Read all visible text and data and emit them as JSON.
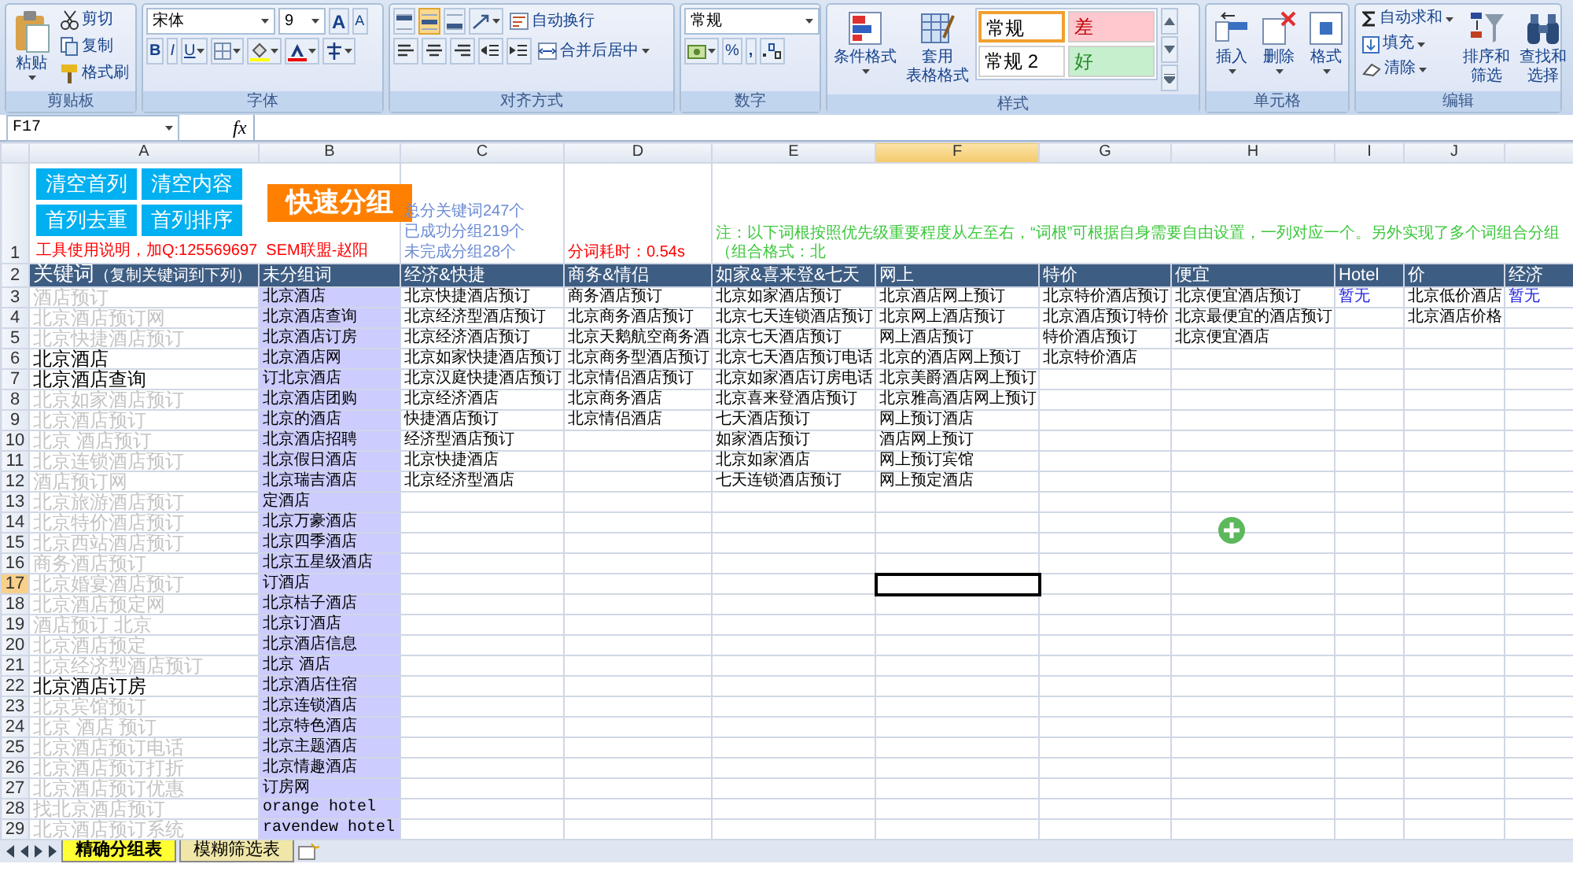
{
  "ribbon": {
    "clipboard": {
      "label": "剪贴板",
      "paste": "粘贴",
      "cut": "剪切",
      "copy": "复制",
      "format_painter": "格式刷"
    },
    "font": {
      "label": "字体",
      "font_name": "宋体",
      "font_size": "9",
      "grow": "A",
      "shrink": "A",
      "bold": "B",
      "italic": "I",
      "underline": "U"
    },
    "alignment": {
      "label": "对齐方式",
      "wrap_text": "自动换行",
      "merge_center": "合并后居中",
      "vertical_align": [
        {
          "selected": false
        },
        {
          "selected": true
        },
        {
          "selected": false
        }
      ]
    },
    "number": {
      "label": "数字",
      "format": "常规",
      "percent": "%",
      "comma": ","
    },
    "styles": {
      "label": "样式",
      "conditional_format": "条件格式",
      "table_format": [
        "套用",
        "表格格式"
      ],
      "cell_styles": [
        {
          "label": "常规",
          "color": "#ffffff",
          "selected": true
        },
        {
          "label": "差",
          "color": "#ffc7ce",
          "selected": false
        },
        {
          "label": "常规 2",
          "color": "#ffffff",
          "selected": false
        },
        {
          "label": "好",
          "color": "#c6efce",
          "selected": false
        }
      ]
    },
    "cells": {
      "label": "单元格",
      "buttons": [
        "插入",
        "删除",
        "格式"
      ]
    },
    "editing": {
      "label": "编辑",
      "autosum": "自动求和",
      "fill": "填充",
      "clear": "清除",
      "sort_filter": [
        "排序和",
        "筛选"
      ],
      "find_select": [
        "查找和",
        "选择"
      ]
    }
  },
  "formula_bar": {
    "name_box": "F17",
    "fx": "fx"
  },
  "sheet": {
    "columns": [
      {
        "letter": "A",
        "selected": false
      },
      {
        "letter": "B",
        "selected": false
      },
      {
        "letter": "C",
        "selected": false
      },
      {
        "letter": "D",
        "selected": false
      },
      {
        "letter": "E",
        "selected": false
      },
      {
        "letter": "F",
        "selected": true
      },
      {
        "letter": "G",
        "selected": false
      },
      {
        "letter": "H",
        "selected": false
      },
      {
        "letter": "I",
        "selected": false
      },
      {
        "letter": "J",
        "selected": false
      }
    ],
    "rows": [
      {
        "number": "1",
        "selected": false
      },
      {
        "number": "2",
        "selected": false
      },
      {
        "number": "3",
        "selected": false
      },
      {
        "number": "4",
        "selected": false
      },
      {
        "number": "5",
        "selected": false
      },
      {
        "number": "6",
        "selected": false
      },
      {
        "number": "7",
        "selected": false
      },
      {
        "number": "8",
        "selected": false
      },
      {
        "number": "9",
        "selected": false
      },
      {
        "number": "10",
        "selected": false
      },
      {
        "number": "11",
        "selected": false
      },
      {
        "number": "12",
        "selected": false
      },
      {
        "number": "13",
        "selected": false
      },
      {
        "number": "14",
        "selected": false
      },
      {
        "number": "15",
        "selected": false
      },
      {
        "number": "16",
        "selected": false
      },
      {
        "number": "17",
        "selected": true
      },
      {
        "number": "18",
        "selected": false
      },
      {
        "number": "19",
        "selected": false
      },
      {
        "number": "20",
        "selected": false
      },
      {
        "number": "21",
        "selected": false
      },
      {
        "number": "22",
        "selected": false
      },
      {
        "number": "23",
        "selected": false
      },
      {
        "number": "24",
        "selected": false
      },
      {
        "number": "25",
        "selected": false
      },
      {
        "number": "26",
        "selected": false
      },
      {
        "number": "27",
        "selected": false
      },
      {
        "number": "28",
        "selected": false
      },
      {
        "number": "29",
        "selected": false
      }
    ],
    "tools": {
      "buttons": [
        "清空首列",
        "清空内容",
        "首列去重",
        "首列排序"
      ],
      "group_button": "快速分组",
      "note": "工具使用说明，加Q:125569697  SEM联盟-赵阳"
    },
    "stats": [
      "总分关键词247个",
      "已成功分组219个",
      "未完成分组28个"
    ],
    "timing": "分词耗时：0.54s",
    "notice": "注：以下词根按照优先级重要程度从左至右，“词根”可根据自身需要自由设置，一列对应一个。另外实现了多个词组合分组（组合格式：北",
    "keyword_header": {
      "label": "关键词",
      "note": "（复制关键词到下列）"
    },
    "keywords": [
      {
        "text": "酒店预订",
        "dimmed": true
      },
      {
        "text": "北京酒店预订网",
        "dimmed": true
      },
      {
        "text": "北京快捷酒店预订",
        "dimmed": true
      },
      {
        "text": "北京酒店",
        "dimmed": false
      },
      {
        "text": "北京酒店查询",
        "dimmed": false
      },
      {
        "text": "北京如家酒店预订",
        "dimmed": true
      },
      {
        "text": "北京酒店预订",
        "dimmed": true
      },
      {
        "text": "北京 酒店预订",
        "dimmed": true
      },
      {
        "text": "北京连锁酒店预订",
        "dimmed": true
      },
      {
        "text": "酒店预订网",
        "dimmed": true
      },
      {
        "text": "北京旅游酒店预订",
        "dimmed": true
      },
      {
        "text": "北京特价酒店预订",
        "dimmed": true
      },
      {
        "text": "北京西站酒店预订",
        "dimmed": true
      },
      {
        "text": "商务酒店预订",
        "dimmed": true
      },
      {
        "text": "北京婚宴酒店预订",
        "dimmed": true
      },
      {
        "text": "北京酒店预定网",
        "dimmed": true
      },
      {
        "text": "酒店预订 北京",
        "dimmed": true
      },
      {
        "text": "北京酒店预定",
        "dimmed": true
      },
      {
        "text": "北京经济型酒店预订",
        "dimmed": true
      },
      {
        "text": "北京酒店订房",
        "dimmed": false
      },
      {
        "text": "北京宾馆预订",
        "dimmed": true
      },
      {
        "text": "北京 酒店 预订",
        "dimmed": true
      },
      {
        "text": "北京酒店预订电话",
        "dimmed": true
      },
      {
        "text": "北京酒店预订打折",
        "dimmed": true
      },
      {
        "text": "北京酒店预订优惠",
        "dimmed": true
      },
      {
        "text": "找北京酒店预订",
        "dimmed": true
      },
      {
        "text": "北京酒店预订系统",
        "dimmed": true
      }
    ],
    "groups": [
      {
        "header": "未分组词",
        "words": [
          "北京酒店",
          "北京酒店查询",
          "北京酒店订房",
          "北京酒店网",
          "订北京酒店",
          "北京酒店团购",
          "北京的酒店",
          "北京酒店招聘",
          "北京假日酒店",
          "北京瑞吉酒店",
          "定酒店",
          "北京万豪酒店",
          "北京四季酒店",
          "北京五星级酒店",
          "订酒店",
          "北京桔子酒店",
          "北京订酒店",
          "北京酒店信息",
          "北京 酒店",
          "北京酒店住宿",
          "北京连锁酒店",
          "北京特色酒店",
          "北京主题酒店",
          "北京情趣酒店",
          "订房网",
          "orange hotel",
          "ravendew hotel"
        ]
      },
      {
        "header": "经济&快捷",
        "words": [
          "北京快捷酒店预订",
          "北京经济型酒店预订",
          "北京经济酒店预订",
          "北京如家快捷酒店预订",
          "北京汉庭快捷酒店预订",
          "北京经济酒店",
          "快捷酒店预订",
          "经济型酒店预订",
          "北京快捷酒店",
          "北京经济型酒店"
        ]
      },
      {
        "header": "商务&情侣",
        "words": [
          "商务酒店预订",
          "北京商务酒店预订",
          "北京天鹅航空商务酒",
          "北京商务型酒店预订",
          "北京情侣酒店预订",
          "北京商务酒店",
          "北京情侣酒店"
        ]
      },
      {
        "header": "如家&喜来登&七天",
        "words": [
          "北京如家酒店预订",
          "北京七天连锁酒店预订",
          "北京七天酒店预订",
          "北京七天酒店预订电话",
          "北京如家酒店订房电话",
          "北京喜来登酒店预订",
          "七天酒店预订",
          "如家酒店预订",
          "北京如家酒店",
          "七天连锁酒店预订"
        ]
      },
      {
        "header": "网上",
        "words": [
          "北京酒店网上预订",
          "北京网上酒店预订",
          "网上酒店预订",
          "北京的酒店网上预订",
          "北京美爵酒店网上预订",
          "北京雅高酒店网上预订",
          "网上预订酒店",
          "酒店网上预订",
          "网上预订宾馆",
          "网上预定酒店"
        ]
      },
      {
        "header": "特价",
        "words": [
          "北京特价酒店预订",
          "北京酒店预订特价",
          "特价酒店预订",
          "北京特价酒店"
        ]
      },
      {
        "header": "便宜",
        "words": [
          "北京便宜酒店预订",
          "北京最便宜的酒店预订",
          "北京便宜酒店"
        ]
      },
      {
        "header": "Hotel",
        "empty_note": "暂无"
      },
      {
        "header": "价",
        "words": [
          "北京低价酒店",
          "北京酒店价格"
        ]
      },
      {
        "header": "经济",
        "empty_note": "暂无"
      }
    ],
    "tabs": [
      {
        "label": "精确分组表",
        "selected": true
      },
      {
        "label": "模糊筛选表",
        "selected": false
      }
    ]
  }
}
